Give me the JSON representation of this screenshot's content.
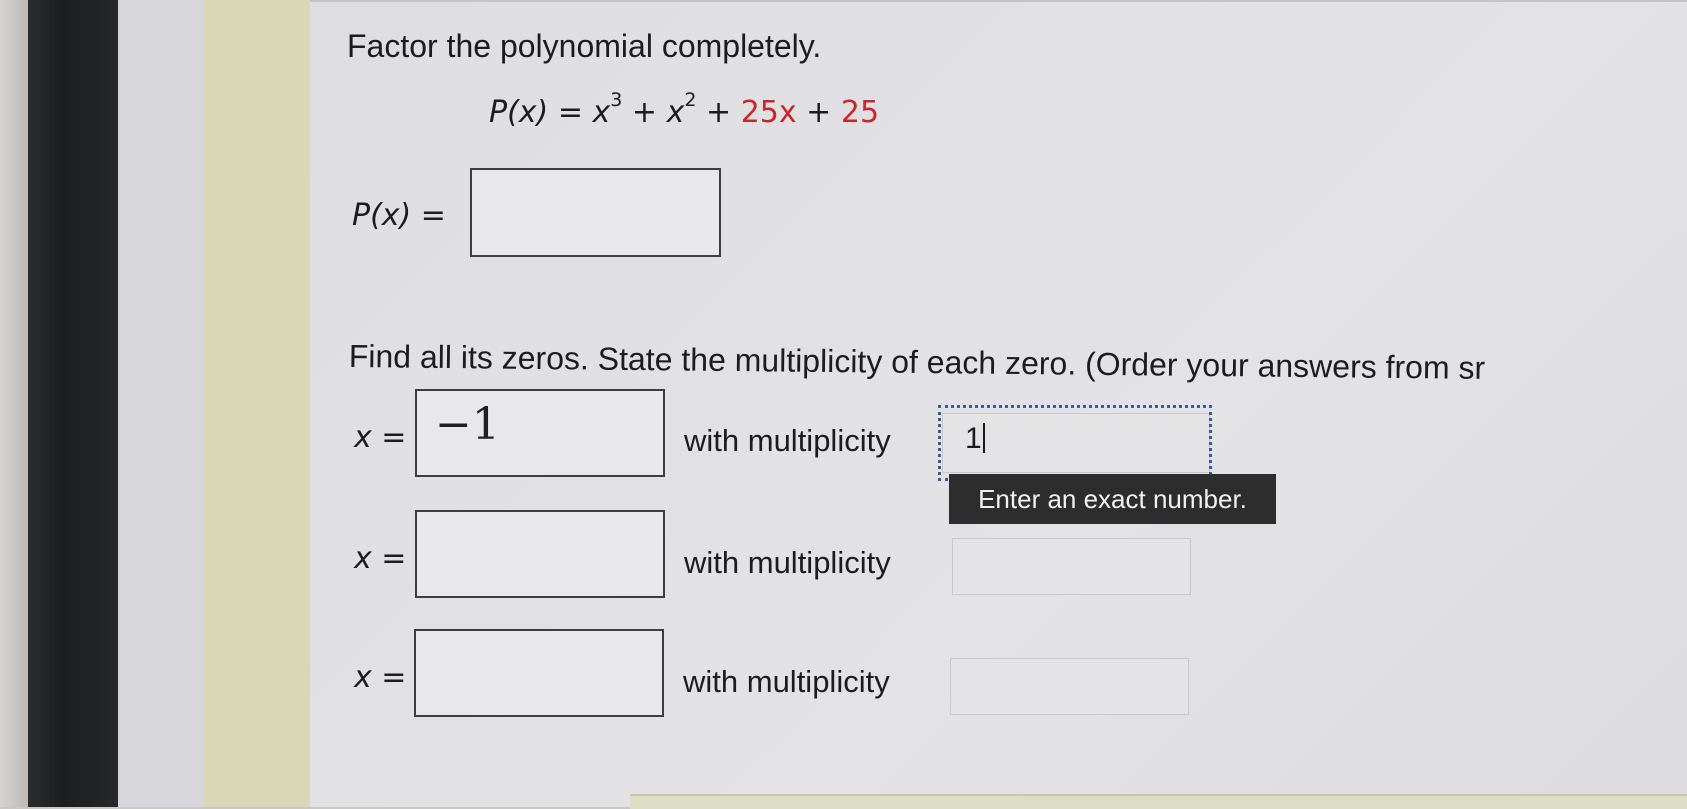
{
  "question": {
    "factor_prompt": "Factor the polynomial completely.",
    "polynomial": {
      "lhs": "P(x)",
      "equals": "=",
      "term1_base": "x",
      "term1_exp": "3",
      "plus1": "+",
      "term2_base": "x",
      "term2_exp": "2",
      "plus2": "+",
      "term3": "25x",
      "plus3": "+",
      "term4": "25"
    },
    "answer_label": "P(x) =",
    "answer_value": ""
  },
  "zeros": {
    "prompt": "Find all its zeros. State the multiplicity of each zero. (Order your answers from sr",
    "x_label": "x =",
    "multiplicity_label": "with multiplicity",
    "rows": [
      {
        "zero": "−1",
        "multiplicity": "1"
      },
      {
        "zero": "",
        "multiplicity": ""
      },
      {
        "zero": "",
        "multiplicity": ""
      }
    ]
  },
  "tooltip": {
    "text": "Enter an exact number."
  },
  "colors": {
    "coefficient_red": "#c8262b",
    "tooltip_bg": "#2d2d2d",
    "focus_outline": "#3a5b9b"
  }
}
